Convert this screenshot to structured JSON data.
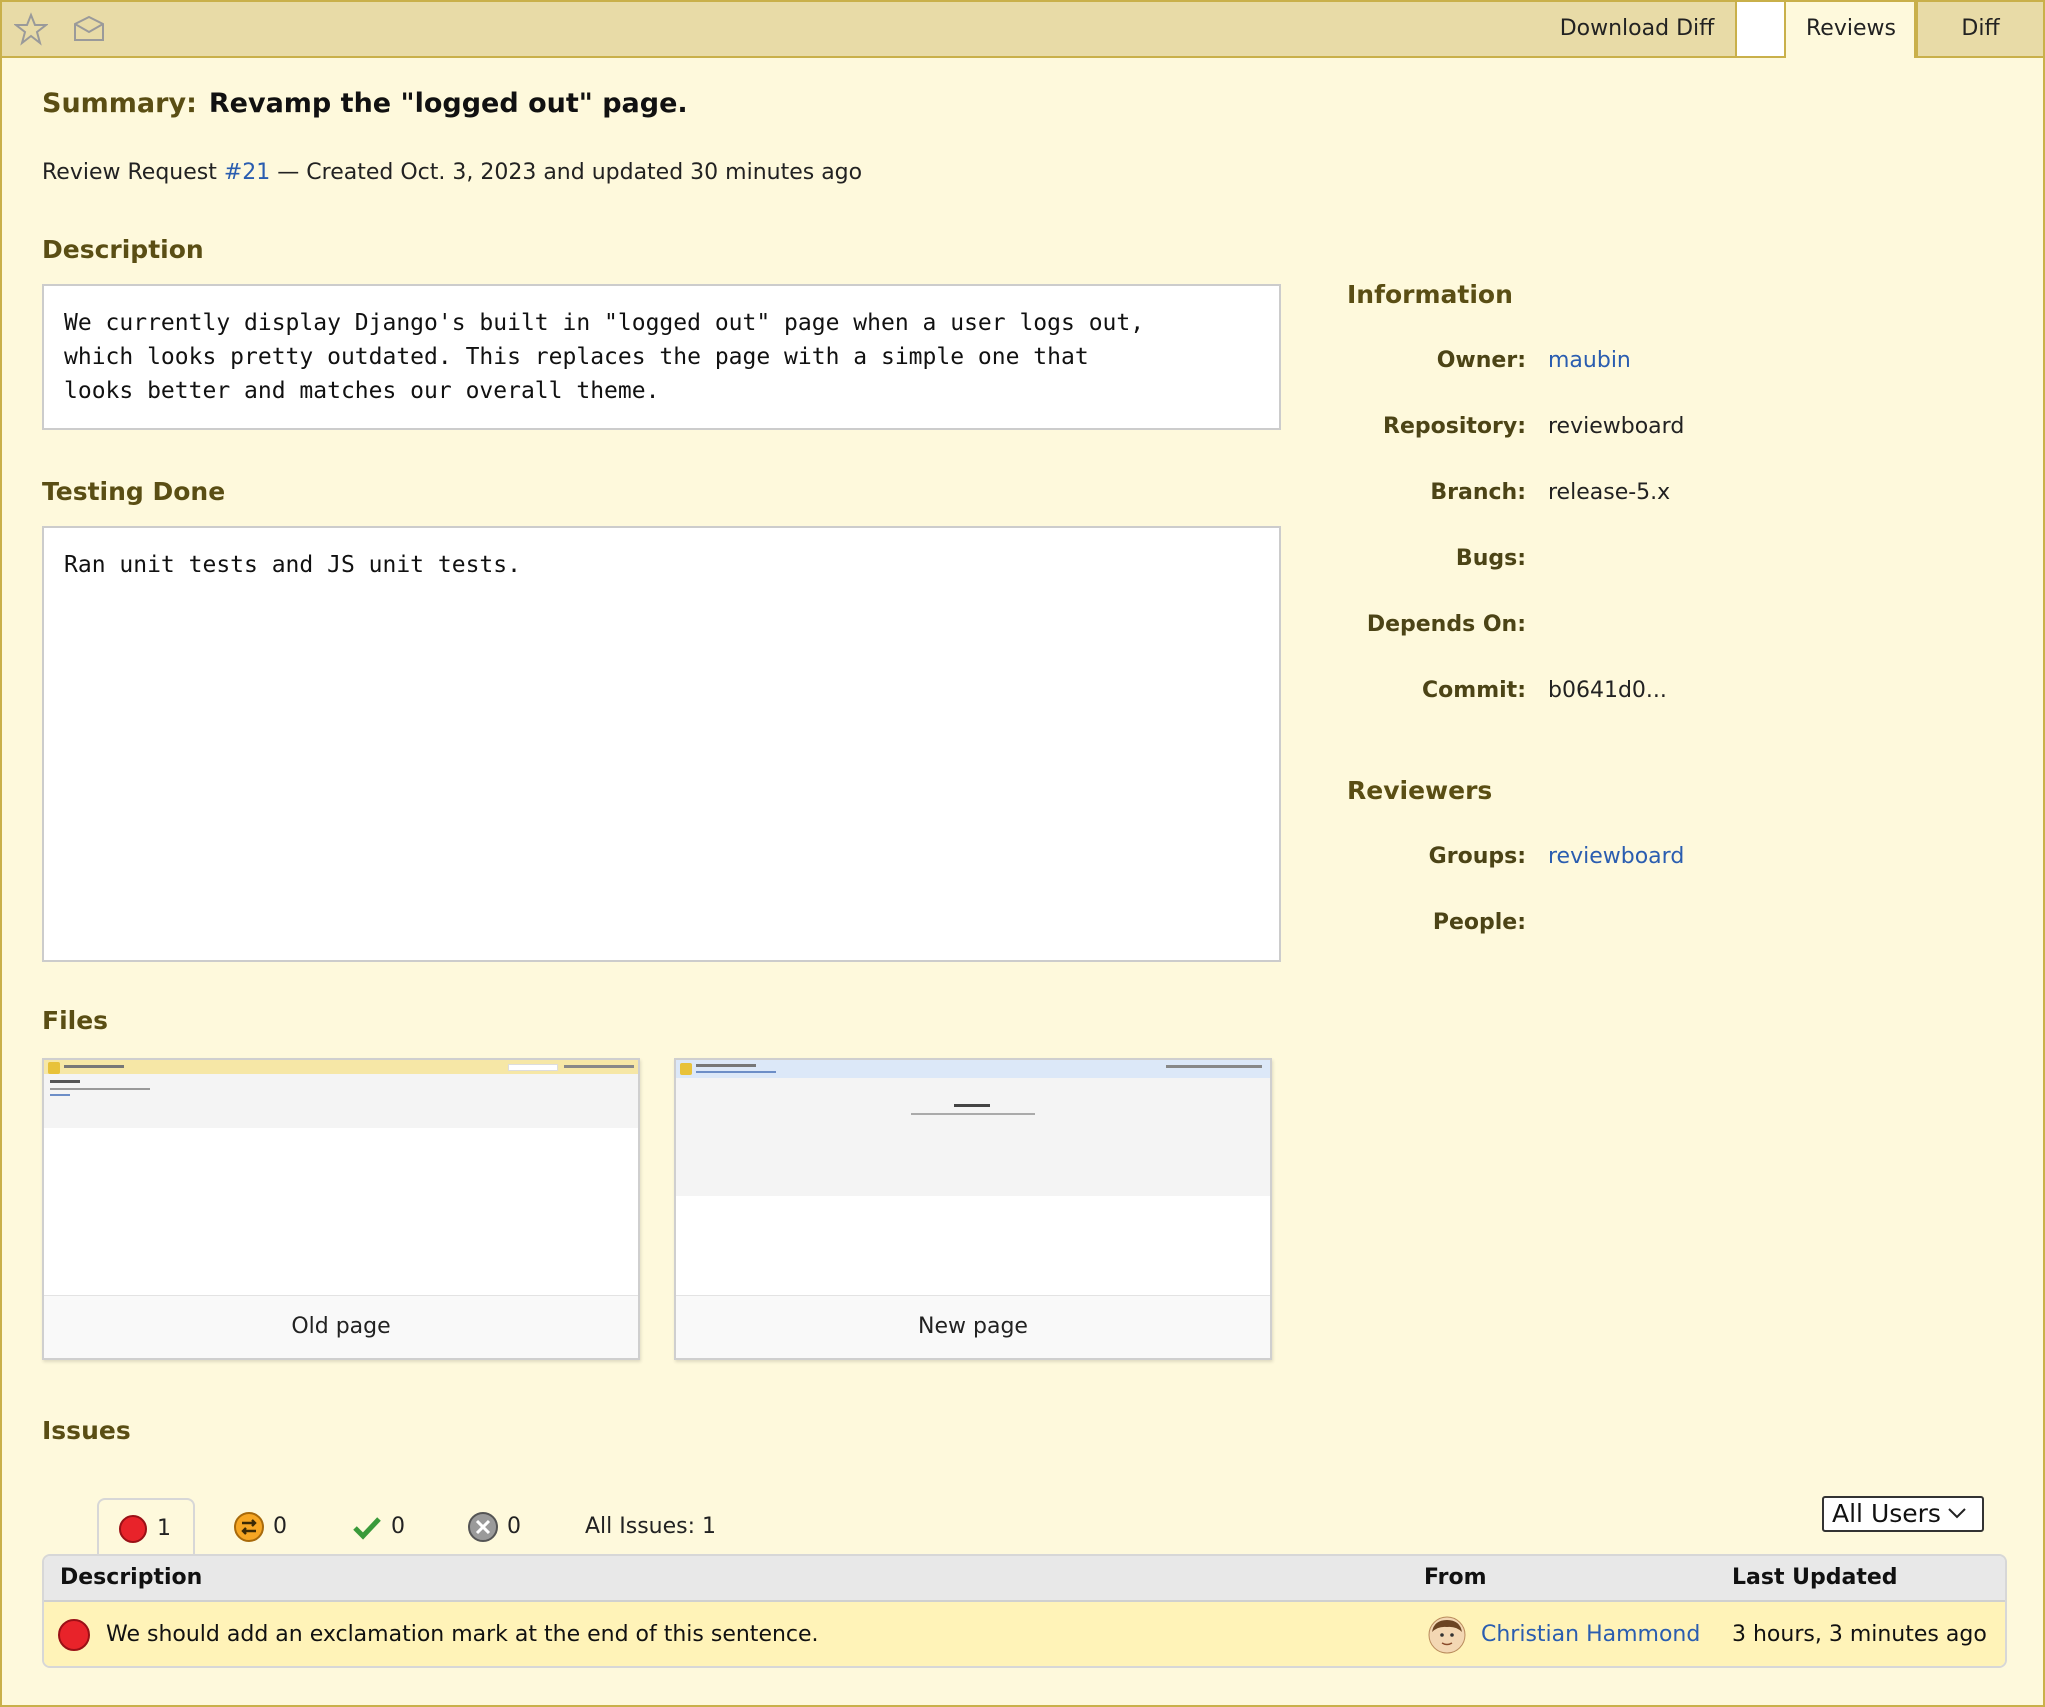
{
  "tabs": {
    "download_diff": "Download Diff",
    "reviews": "Reviews",
    "diff": "Diff"
  },
  "summary": {
    "label": "Summary:",
    "value": "Revamp the \"logged out\" page."
  },
  "meta": {
    "prefix": "Review Request ",
    "id_link": "#21",
    "suffix": " — Created Oct. 3, 2023 and updated 30 minutes ago"
  },
  "description": {
    "heading": "Description",
    "text": "We currently display Django's built in \"logged out\" page when a user logs out,\nwhich looks pretty outdated. This replaces the page with a simple one that\nlooks better and matches our overall theme."
  },
  "testing": {
    "heading": "Testing Done",
    "text": "Ran unit tests and JS unit tests."
  },
  "information": {
    "heading": "Information",
    "owner_label": "Owner:",
    "owner": "maubin",
    "repository_label": "Repository:",
    "repository": "reviewboard",
    "branch_label": "Branch:",
    "branch": "release-5.x",
    "bugs_label": "Bugs:",
    "depends_label": "Depends On:",
    "commit_label": "Commit:",
    "commit": "b0641d0..."
  },
  "reviewers": {
    "heading": "Reviewers",
    "groups_label": "Groups:",
    "groups": "reviewboard",
    "people_label": "People:"
  },
  "files": {
    "heading": "Files",
    "items": [
      {
        "caption": "Old page"
      },
      {
        "caption": "New page"
      }
    ]
  },
  "issues": {
    "heading": "Issues",
    "counts": {
      "open": "1",
      "verifying": "0",
      "resolved": "0",
      "dropped": "0"
    },
    "all_issues": "All Issues: 1",
    "filter": "All Users",
    "columns": {
      "description": "Description",
      "from": "From",
      "last_updated": "Last Updated"
    },
    "rows": [
      {
        "description": "We should add an exclamation mark at the end of this sentence.",
        "from": "Christian Hammond",
        "last_updated": "3 hours, 3 minutes ago"
      }
    ]
  },
  "colors": {
    "accent_border": "#c9b04a",
    "heading": "#5a4e14",
    "link": "#2a5db0",
    "open_issue": "#e8232a"
  }
}
